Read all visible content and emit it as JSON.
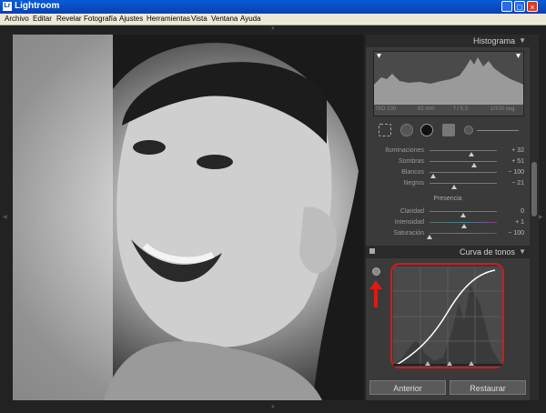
{
  "window": {
    "title": "Lightroom",
    "icon": "Lr"
  },
  "menu": [
    "Archivo",
    "Editar",
    "Revelar",
    "Fotografía",
    "Ajustes",
    "Herramientas",
    "Vista",
    "Ventana",
    "Ayuda"
  ],
  "histogram": {
    "header": "Histograma",
    "info": {
      "iso": "ISO 100",
      "focal": "62 mm",
      "aperture": "f / 5,3",
      "shutter": "1/100 seg."
    }
  },
  "tone_sliders": [
    {
      "label": "Iluminaciones",
      "value": "+ 32",
      "pos": 0.62
    },
    {
      "label": "Sombras",
      "value": "+ 51",
      "pos": 0.66
    },
    {
      "label": "Blancos",
      "value": "− 100",
      "pos": 0.05
    },
    {
      "label": "Negros",
      "value": "− 21",
      "pos": 0.36
    }
  ],
  "presence": {
    "title": "Presencia",
    "sliders": [
      {
        "label": "Claridad",
        "value": "0",
        "pos": 0.5
      },
      {
        "label": "Intensidad",
        "value": "+ 1",
        "pos": 0.51
      },
      {
        "label": "Saturación",
        "value": "− 100",
        "pos": 0.0
      }
    ]
  },
  "tone_curve": {
    "header": "Curva de tonos"
  },
  "buttons": {
    "previous": "Anterior",
    "reset": "Restaurar"
  },
  "colors": {
    "highlight_box": "#d81818",
    "panel_bg": "#3a3a3a",
    "title_blue": "#0840b0"
  }
}
